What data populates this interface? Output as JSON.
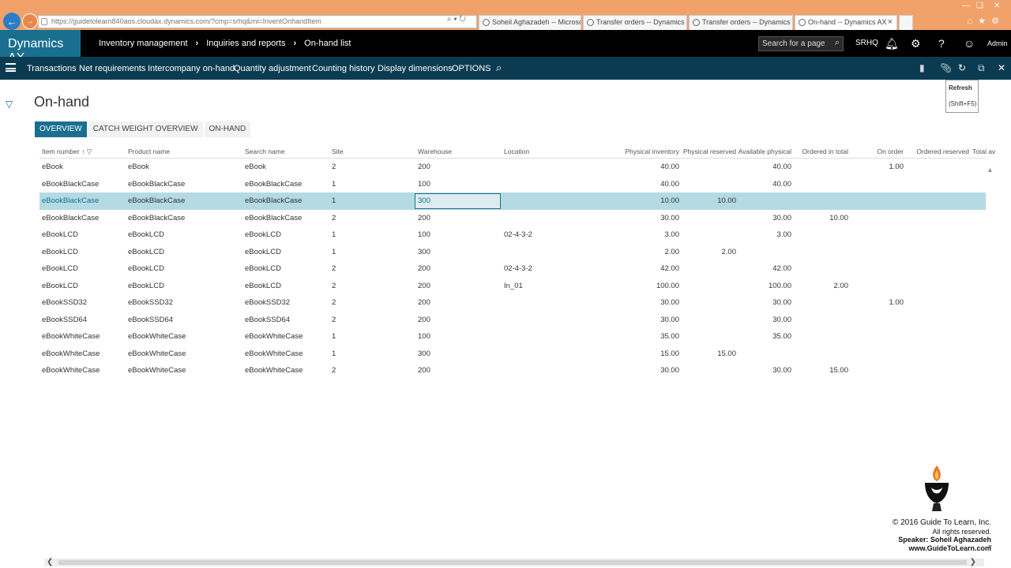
{
  "browser": {
    "url": "https://guidetolearn840aos.cloudax.dynamics.com/?cmp=srhq&mi=InventOnhandItem",
    "tabs": [
      {
        "label": "Soheil Aghazadeh -- Microsoft..."
      },
      {
        "label": "Transfer orders -- Dynamics AX"
      },
      {
        "label": "Transfer orders -- Dynamics AX"
      },
      {
        "label": "On-hand -- Dynamics AX"
      }
    ]
  },
  "header": {
    "brand": "Dynamics AX",
    "breadcrumb": [
      "Inventory management",
      "Inquiries and reports",
      "On-hand list"
    ],
    "search_placeholder": "Search for a page",
    "company": "SRHQ",
    "user": "Admin"
  },
  "actions": [
    "Transactions",
    "Net requirements",
    "Intercompany on-hand",
    "Quantity adjustment",
    "Counting history",
    "Display dimensions",
    "OPTIONS"
  ],
  "tooltip": {
    "title": "Refresh",
    "shortcut": "(Shift+F5)"
  },
  "page": {
    "title": "On-hand",
    "view_tabs": [
      "OVERVIEW",
      "CATCH WEIGHT OVERVIEW",
      "ON-HAND"
    ]
  },
  "grid": {
    "columns": {
      "item": "Item number",
      "sort_icon": "↑",
      "product": "Product name",
      "search": "Search name",
      "site": "Site",
      "warehouse": "Warehouse",
      "location": "Location",
      "phys_inv": "Physical inventory",
      "phys_res": "Physical reserved",
      "avail": "Available physical",
      "ordered": "Ordered in total",
      "on_order": "On order",
      "ord_res": "Ordered reserved",
      "total_av": "Total av"
    },
    "rows": [
      {
        "item": "eBook",
        "product": "eBook",
        "search": "eBook",
        "site": "2",
        "warehouse": "200",
        "location": "",
        "phys_inv": "40.00",
        "phys_res": "",
        "avail": "40.00",
        "ordered": "",
        "on_order": "1.00",
        "ord_res": ""
      },
      {
        "item": "eBookBlackCase",
        "product": "eBookBlackCase",
        "search": "eBookBlackCase",
        "site": "1",
        "warehouse": "100",
        "location": "",
        "phys_inv": "40.00",
        "phys_res": "",
        "avail": "40.00",
        "ordered": "",
        "on_order": "",
        "ord_res": ""
      },
      {
        "item": "eBookBlackCase",
        "product": "eBookBlackCase",
        "search": "eBookBlackCase",
        "site": "1",
        "warehouse": "300",
        "location": "",
        "phys_inv": "10.00",
        "phys_res": "10.00",
        "avail": "",
        "ordered": "",
        "on_order": "",
        "ord_res": ""
      },
      {
        "item": "eBookBlackCase",
        "product": "eBookBlackCase",
        "search": "eBookBlackCase",
        "site": "2",
        "warehouse": "200",
        "location": "",
        "phys_inv": "30.00",
        "phys_res": "",
        "avail": "30.00",
        "ordered": "10.00",
        "on_order": "",
        "ord_res": ""
      },
      {
        "item": "eBookLCD",
        "product": "eBookLCD",
        "search": "eBookLCD",
        "site": "1",
        "warehouse": "100",
        "location": "02-4-3-2",
        "phys_inv": "3.00",
        "phys_res": "",
        "avail": "3.00",
        "ordered": "",
        "on_order": "",
        "ord_res": ""
      },
      {
        "item": "eBookLCD",
        "product": "eBookLCD",
        "search": "eBookLCD",
        "site": "1",
        "warehouse": "300",
        "location": "",
        "phys_inv": "2.00",
        "phys_res": "2.00",
        "avail": "",
        "ordered": "",
        "on_order": "",
        "ord_res": ""
      },
      {
        "item": "eBookLCD",
        "product": "eBookLCD",
        "search": "eBookLCD",
        "site": "2",
        "warehouse": "200",
        "location": "02-4-3-2",
        "phys_inv": "42.00",
        "phys_res": "",
        "avail": "42.00",
        "ordered": "",
        "on_order": "",
        "ord_res": ""
      },
      {
        "item": "eBookLCD",
        "product": "eBookLCD",
        "search": "eBookLCD",
        "site": "2",
        "warehouse": "200",
        "location": "In_01",
        "phys_inv": "100.00",
        "phys_res": "",
        "avail": "100.00",
        "ordered": "2.00",
        "on_order": "",
        "ord_res": ""
      },
      {
        "item": "eBookSSD32",
        "product": "eBookSSD32",
        "search": "eBookSSD32",
        "site": "2",
        "warehouse": "200",
        "location": "",
        "phys_inv": "30.00",
        "phys_res": "",
        "avail": "30.00",
        "ordered": "",
        "on_order": "1.00",
        "ord_res": ""
      },
      {
        "item": "eBookSSD64",
        "product": "eBookSSD64",
        "search": "eBookSSD64",
        "site": "2",
        "warehouse": "200",
        "location": "",
        "phys_inv": "30.00",
        "phys_res": "",
        "avail": "30.00",
        "ordered": "",
        "on_order": "",
        "ord_res": ""
      },
      {
        "item": "eBookWhiteCase",
        "product": "eBookWhiteCase",
        "search": "eBookWhiteCase",
        "site": "1",
        "warehouse": "100",
        "location": "",
        "phys_inv": "35.00",
        "phys_res": "",
        "avail": "35.00",
        "ordered": "",
        "on_order": "",
        "ord_res": ""
      },
      {
        "item": "eBookWhiteCase",
        "product": "eBookWhiteCase",
        "search": "eBookWhiteCase",
        "site": "1",
        "warehouse": "300",
        "location": "",
        "phys_inv": "15.00",
        "phys_res": "15.00",
        "avail": "",
        "ordered": "",
        "on_order": "",
        "ord_res": ""
      },
      {
        "item": "eBookWhiteCase",
        "product": "eBookWhiteCase",
        "search": "eBookWhiteCase",
        "site": "2",
        "warehouse": "200",
        "location": "",
        "phys_inv": "30.00",
        "phys_res": "",
        "avail": "30.00",
        "ordered": "15.00",
        "on_order": "",
        "ord_res": ""
      }
    ],
    "selected_row": 2
  },
  "watermark": {
    "lines": [
      "© 2016 Guide To Learn, Inc.",
      "All rights reserved.",
      "Speaker: Soheil Aghazadeh",
      "www.GuideToLearn.com"
    ]
  },
  "colors": {
    "accent": "#1a6f8f",
    "action_bar": "#0b3b50",
    "selected_row": "#b4dbe3",
    "browser_chrome": "#f1a26a"
  }
}
